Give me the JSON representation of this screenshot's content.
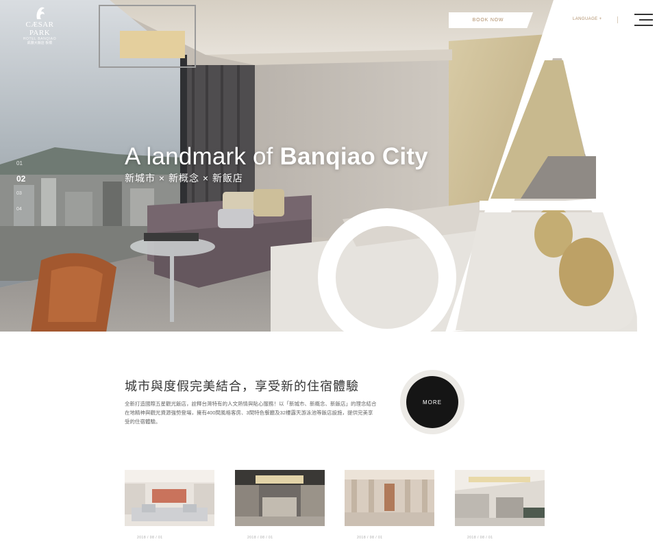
{
  "header": {
    "logo": {
      "name": "CÆSAR PARK",
      "sub": "HOTEL BANQIAO",
      "cn": "凱撒大飯店 板橋"
    },
    "book_label": "BOOK NOW",
    "language_label": "LANGUAGE +",
    "menu_icon": "hamburger-menu-icon"
  },
  "hero": {
    "title_light": "A landmark of ",
    "title_bold": "Banqiao City",
    "subtitle": "新城市 × 新概念 × 新飯店",
    "slides": [
      "01",
      "02",
      "03",
      "04"
    ],
    "active_slide": "02"
  },
  "intro": {
    "title": "城市與度假完美結合，享受新的住宿體驗",
    "body": "全新打造國際五星觀光飯店，詮釋台灣特有的人文熱情與貼心服務！以「新城市、新概念、新飯店」的理念結合在地精神與觀光資源強勢登場，擁有400間風格客房、3間特色餐廳及32樓露天游泳池等飯店設施，提供完美享受的住宿體驗。",
    "more_label": "MORE"
  },
  "gallery": {
    "items": [
      {
        "meta": "2018 / 08 / 01"
      },
      {
        "meta": "2018 / 08 / 01"
      },
      {
        "meta": "2018 / 08 / 01"
      },
      {
        "meta": "2018 / 08 / 01"
      }
    ]
  },
  "colors": {
    "accent": "#b08f6a",
    "dark": "#151515",
    "white": "#ffffff"
  }
}
